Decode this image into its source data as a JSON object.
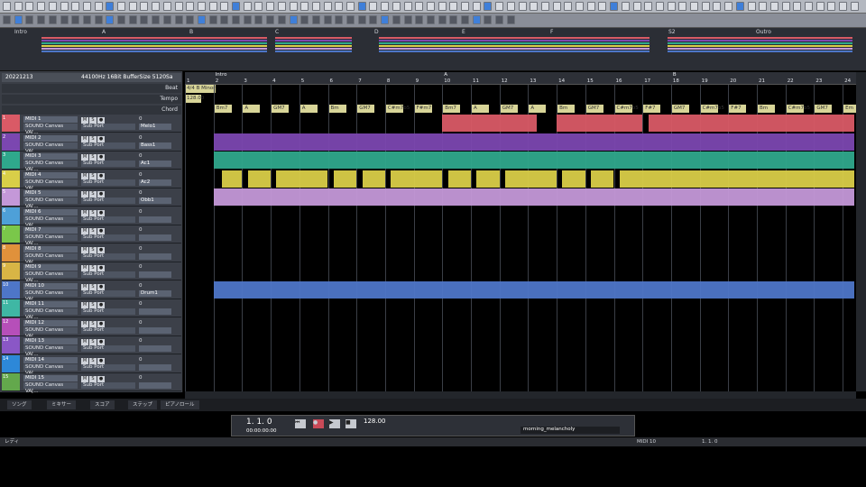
{
  "toolbar": {
    "position": "1 . 1 . 0"
  },
  "overview": {
    "sections": [
      "Intro",
      "A",
      "B",
      "C",
      "D",
      "E",
      "F",
      "S2",
      "Outro"
    ]
  },
  "song": {
    "name": "20221213",
    "audio": "44100Hz 16Bit BufferSize 5120Sa"
  },
  "rows": {
    "beat": "Beat",
    "tempo": "Tempo",
    "chord": "Chord"
  },
  "beat_value": "4/4 B Minor",
  "tempo_value": "128.00",
  "sections": [
    {
      "label": "Intro",
      "bar": 2
    },
    {
      "label": "A",
      "bar": 10
    },
    {
      "label": "B",
      "bar": 18
    }
  ],
  "bars": [
    "1",
    "2",
    "3",
    "4",
    "5",
    "6",
    "7",
    "8",
    "9",
    "10",
    "11",
    "12",
    "13",
    "14",
    "15",
    "16",
    "17",
    "18",
    "19",
    "20",
    "21",
    "22",
    "23",
    "24"
  ],
  "chords": [
    "Bm7",
    "A",
    "GM7",
    "A",
    "Bm",
    "GM7",
    "C#m7b5",
    "F#m7",
    "Bm7",
    "A",
    "GM7",
    "A",
    "Bm",
    "GM7",
    "C#m7b5",
    "F#7",
    "GM7",
    "C#m7b5",
    "F#7",
    "Bm",
    "C#m7b5",
    "GM7",
    "Em"
  ],
  "tracks": [
    {
      "num": "1",
      "name": "MIDI 1",
      "port": "SOUND Canvas VA[...",
      "sub": "Sub Port",
      "val": "0",
      "patch": "Melo1",
      "color": "#d95a66"
    },
    {
      "num": "2",
      "name": "MIDI 2",
      "port": "SOUND Canvas VA[...",
      "sub": "Sub Port",
      "val": "0",
      "patch": "Bass1",
      "color": "#7b47b0"
    },
    {
      "num": "3",
      "name": "MIDI 3",
      "port": "SOUND Canvas VA[...",
      "sub": "Sub Port",
      "val": "0",
      "patch": "Ac1",
      "color": "#2fa88c"
    },
    {
      "num": "4",
      "name": "MIDI 4",
      "port": "SOUND Canvas VA[...",
      "sub": "Sub Port",
      "val": "0",
      "patch": "Ac2",
      "color": "#d9ce48"
    },
    {
      "num": "5",
      "name": "MIDI 5",
      "port": "SOUND Canvas VA[...",
      "sub": "Sub Port",
      "val": "0",
      "patch": "Obb1",
      "color": "#c498d8"
    },
    {
      "num": "6",
      "name": "MIDI 6",
      "port": "SOUND Canvas VA[...",
      "sub": "Sub Port",
      "val": "0",
      "patch": "",
      "color": "#4ea0d8"
    },
    {
      "num": "7",
      "name": "MIDI 7",
      "port": "SOUND Canvas VA[...",
      "sub": "Sub Port",
      "val": "0",
      "patch": "",
      "color": "#7ac74a"
    },
    {
      "num": "8",
      "name": "MIDI 8",
      "port": "SOUND Canvas VA[...",
      "sub": "Sub Port",
      "val": "0",
      "patch": "",
      "color": "#e0913b"
    },
    {
      "num": "9",
      "name": "MIDI 9",
      "port": "SOUND Canvas VA[...",
      "sub": "Sub Port",
      "val": "0",
      "patch": "",
      "color": "#d8b545"
    },
    {
      "num": "10",
      "name": "MIDI 10",
      "port": "SOUND Canvas VA[...",
      "sub": "Sub Port",
      "val": "0",
      "patch": "Drum1",
      "color": "#4e76c8"
    },
    {
      "num": "11",
      "name": "MIDI 11",
      "port": "SOUND Canvas VA[...",
      "sub": "Sub Port",
      "val": "0",
      "patch": "",
      "color": "#3fb7a4"
    },
    {
      "num": "12",
      "name": "MIDI 12",
      "port": "SOUND Canvas VA[...",
      "sub": "Sub Port",
      "val": "0",
      "patch": "",
      "color": "#b64fb9"
    },
    {
      "num": "13",
      "name": "MIDI 13",
      "port": "SOUND Canvas VA[...",
      "sub": "Sub Port",
      "val": "0",
      "patch": "",
      "color": "#8a57c6"
    },
    {
      "num": "14",
      "name": "MIDI 14",
      "port": "SOUND Canvas VA[...",
      "sub": "Sub Port",
      "val": "0",
      "patch": "",
      "color": "#2d88d8"
    },
    {
      "num": "15",
      "name": "MIDI 15",
      "port": "SOUND Canvas VA[...",
      "sub": "Sub Port",
      "val": "0",
      "patch": "",
      "color": "#63a84c"
    }
  ],
  "tabs": [
    "ソング",
    "ミキサー",
    "スコア",
    "ステップ",
    "ピアノロール"
  ],
  "transport": {
    "counter": "1. 1. 0",
    "time": "00:00:00:00",
    "tempo": "128.00"
  },
  "filename": "morning_melancholy",
  "status": {
    "left": "レディ",
    "track": "MIDI 10",
    "pos": "1. 1. 0"
  }
}
